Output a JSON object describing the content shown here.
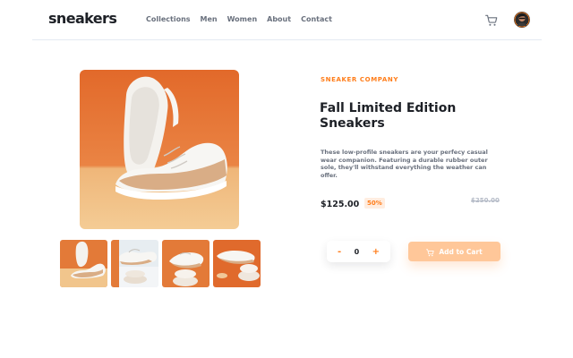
{
  "header": {
    "logo": "sneakers",
    "nav": [
      "Collections",
      "Men",
      "Women",
      "About",
      "Contact"
    ]
  },
  "product": {
    "company": "SNEAKER COMPANY",
    "title": "Fall Limited Edition Sneakers",
    "description": "These low-profile sneakers are your perfecy casual wear companion. Featuring a durable rubber outer sole, they'll withstand everything the weather can offer.",
    "price": "$125.00",
    "discount": "50%",
    "old_price": "$250.00"
  },
  "quantity": {
    "minus": "-",
    "value": "0",
    "plus": "+"
  },
  "cart_button": {
    "label": "Add to Cart"
  },
  "colors": {
    "accent": "#ff7d1a",
    "accent_pale": "#ffede0",
    "button_disabled": "#ffc799",
    "dark_text": "#1d2026",
    "muted_text": "#69707d",
    "struck_price": "#b6bcc8"
  },
  "icons": [
    "cart-icon",
    "avatar",
    "cart-button-icon"
  ]
}
